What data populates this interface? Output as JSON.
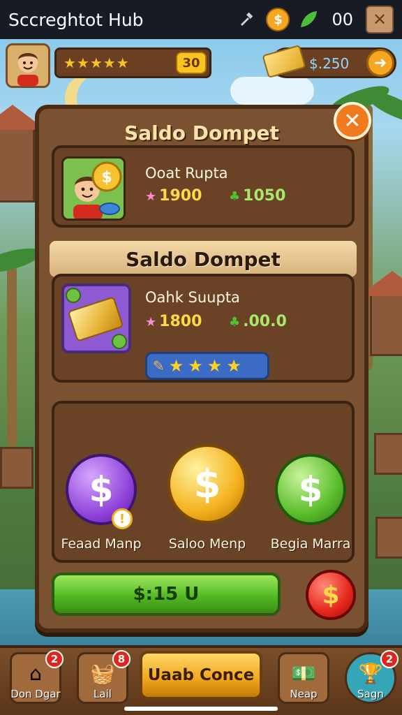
{
  "statusbar": {
    "title": "Sccreghtot Hub",
    "coin_symbol": "$",
    "count": "00",
    "close_glyph": "✕"
  },
  "header": {
    "stars": "★★★★★",
    "level": "30",
    "balance": "$.250",
    "arrow_glyph": "➜"
  },
  "panel": {
    "title": "Saldo Dompet",
    "close_glyph": "✕",
    "card1": {
      "name": "Ooat Rupta",
      "stat_pink": "1900",
      "stat_green": "1050"
    },
    "section_title": "Saldo Dompet",
    "card2": {
      "name": "Oahk Suupta",
      "stat_pink": "1800",
      "stat_green": ".00.0",
      "star_glyphs": [
        "★",
        "★",
        "★",
        "★"
      ]
    },
    "coins": [
      {
        "label": "Feaad Manp",
        "symbol": "$"
      },
      {
        "label": "Saloo Menp",
        "symbol": "$"
      },
      {
        "label": "Begia Marra",
        "symbol": "$"
      }
    ],
    "info_glyph": "!",
    "green_button": "$:15 U",
    "red_coin_symbol": "$"
  },
  "bottom_nav": {
    "items": [
      {
        "label": "Don Dgar",
        "badge": "2",
        "icon": "house-icon"
      },
      {
        "label": "Lail",
        "badge": "8",
        "icon": "shop-basket-icon"
      },
      {
        "label": "Neap",
        "badge": "",
        "icon": "cash-stack-icon"
      },
      {
        "label": "Sagn",
        "badge": "2",
        "icon": "trophy-icon"
      }
    ],
    "center_button": "Uaab Conce"
  },
  "colors": {
    "panel_wood": "#7a5232",
    "accent_gold": "#f7c423",
    "button_green": "#4fb521",
    "button_red": "#e5261c"
  }
}
